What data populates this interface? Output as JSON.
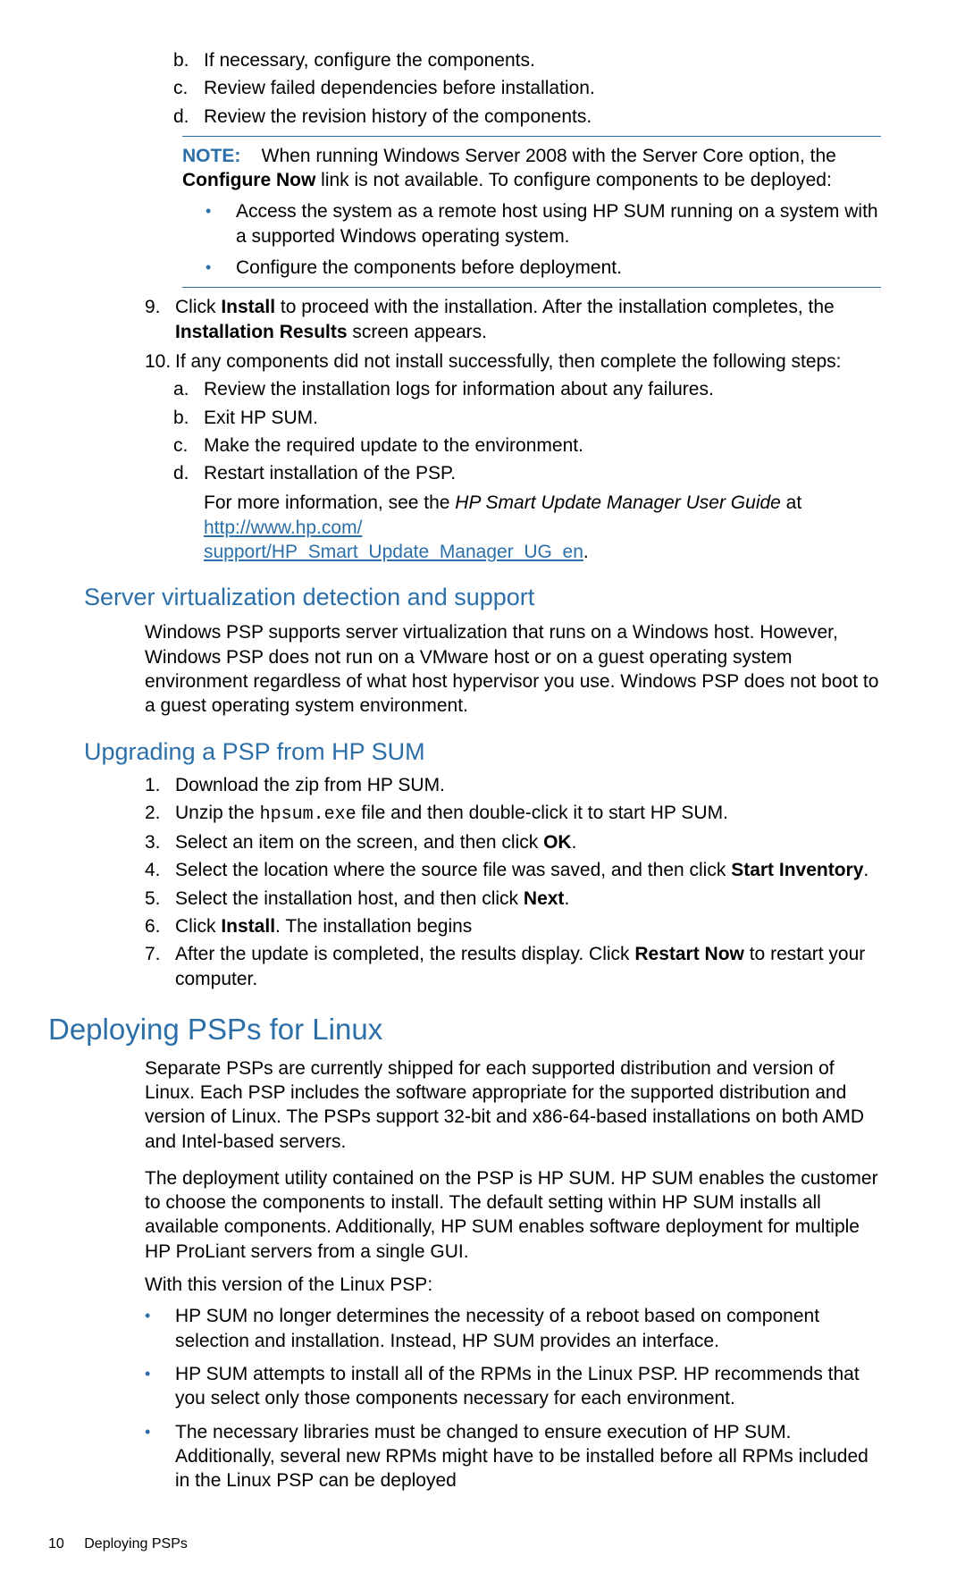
{
  "top_substeps": [
    {
      "mk": "b.",
      "text": "If necessary, configure the components."
    },
    {
      "mk": "c.",
      "text": "Review failed dependencies before installation."
    },
    {
      "mk": "d.",
      "text": "Review the revision history of the components."
    }
  ],
  "note": {
    "label": "NOTE:",
    "lead_1": "When running Windows Server 2008 with the Server Core option, the ",
    "configure_now_1": "Configure",
    "configure_now_2": "Now",
    "lead_2_tail": " link is not available. To configure components to be deployed:",
    "bullets": [
      "Access the system as a remote host using HP SUM running on a system with a supported Windows operating system.",
      "Configure the components before deployment."
    ]
  },
  "step9_mk": "9.",
  "step9_pre": "Click ",
  "step9_install": "Install",
  "step9_mid": " to proceed with the installation. After the installation completes, the ",
  "step9_installation": "Installation",
  "step9_results": "Results",
  "step9_tail": " screen appears.",
  "step10_mk": "10.",
  "step10_text": "If any components did not install successfully, then complete the following steps:",
  "step10_substeps": [
    {
      "mk": "a.",
      "text": "Review the installation logs for information about any failures."
    },
    {
      "mk": "b.",
      "text": "Exit HP SUM."
    },
    {
      "mk": "c.",
      "text": "Make the required update to the environment."
    },
    {
      "mk": "d.",
      "text": "Restart installation of the PSP."
    }
  ],
  "more_pre": "For more information, see the ",
  "more_guide": "HP Smart Update Manager User Guide",
  "more_at": " at ",
  "link1_part1": "http://www.hp.com/",
  "link1_part2": "support/HP_Smart_Update_Manager_UG_en",
  "more_tail": ".",
  "h_virt": "Server virtualization detection and support",
  "virt_para": "Windows PSP supports server virtualization that runs on a Windows host. However, Windows PSP does not run on a VMware host or on a guest operating system environment regardless of what host hypervisor you use. Windows PSP does not boot to a guest operating system environment.",
  "h_upgrade": "Upgrading a PSP from HP SUM",
  "upgrade_steps": {
    "s1_mk": "1.",
    "s1": "Download the zip from HP SUM.",
    "s2_mk": "2.",
    "s2_a": "Unzip the ",
    "s2_code": "hpsum.exe",
    "s2_b": " file and then double-click it to start HP SUM.",
    "s3_mk": "3.",
    "s3_a": "Select an item on the screen, and then click ",
    "s3_ok": "OK",
    "s3_b": ".",
    "s4_mk": "4.",
    "s4_a": "Select the location where the source file was saved, and then click ",
    "s4_start": "Start Inventory",
    "s4_b": ".",
    "s5_mk": "5.",
    "s5_a": "Select the installation host, and then click ",
    "s5_next": "Next",
    "s5_b": ".",
    "s6_mk": "6.",
    "s6_a": "Click ",
    "s6_install": "Install",
    "s6_b": ". The installation begins",
    "s7_mk": "7.",
    "s7_a": "After the update is completed, the results display. Click ",
    "s7_restart": "Restart Now",
    "s7_b": " to restart your computer."
  },
  "h_linux": "Deploying PSPs for Linux",
  "linux_para1": "Separate PSPs are currently shipped for each supported distribution and version of Linux. Each PSP includes the software appropriate for the supported distribution and version of Linux. The PSPs support 32-bit and x86-64-based installations on both AMD and Intel-based servers.",
  "linux_para2": "The deployment utility contained on the PSP is HP SUM. HP SUM enables the customer to choose the components to install. The default setting within HP SUM installs all available components. Additionally, HP SUM enables software deployment for multiple HP ProLiant servers from a single GUI.",
  "linux_para3": "With this version of the Linux PSP:",
  "linux_bullets": [
    "HP SUM no longer determines the necessity of a reboot based on component selection and installation. Instead, HP SUM provides an interface.",
    "HP SUM attempts to install all of the RPMs in the Linux PSP. HP recommends that you select only those components necessary for each environment.",
    "The necessary libraries must be changed to ensure execution of HP SUM. Additionally, several new RPMs might have to be installed before all RPMs included in the Linux PSP can be deployed"
  ],
  "footer_page": "10",
  "footer_title": "Deploying PSPs"
}
